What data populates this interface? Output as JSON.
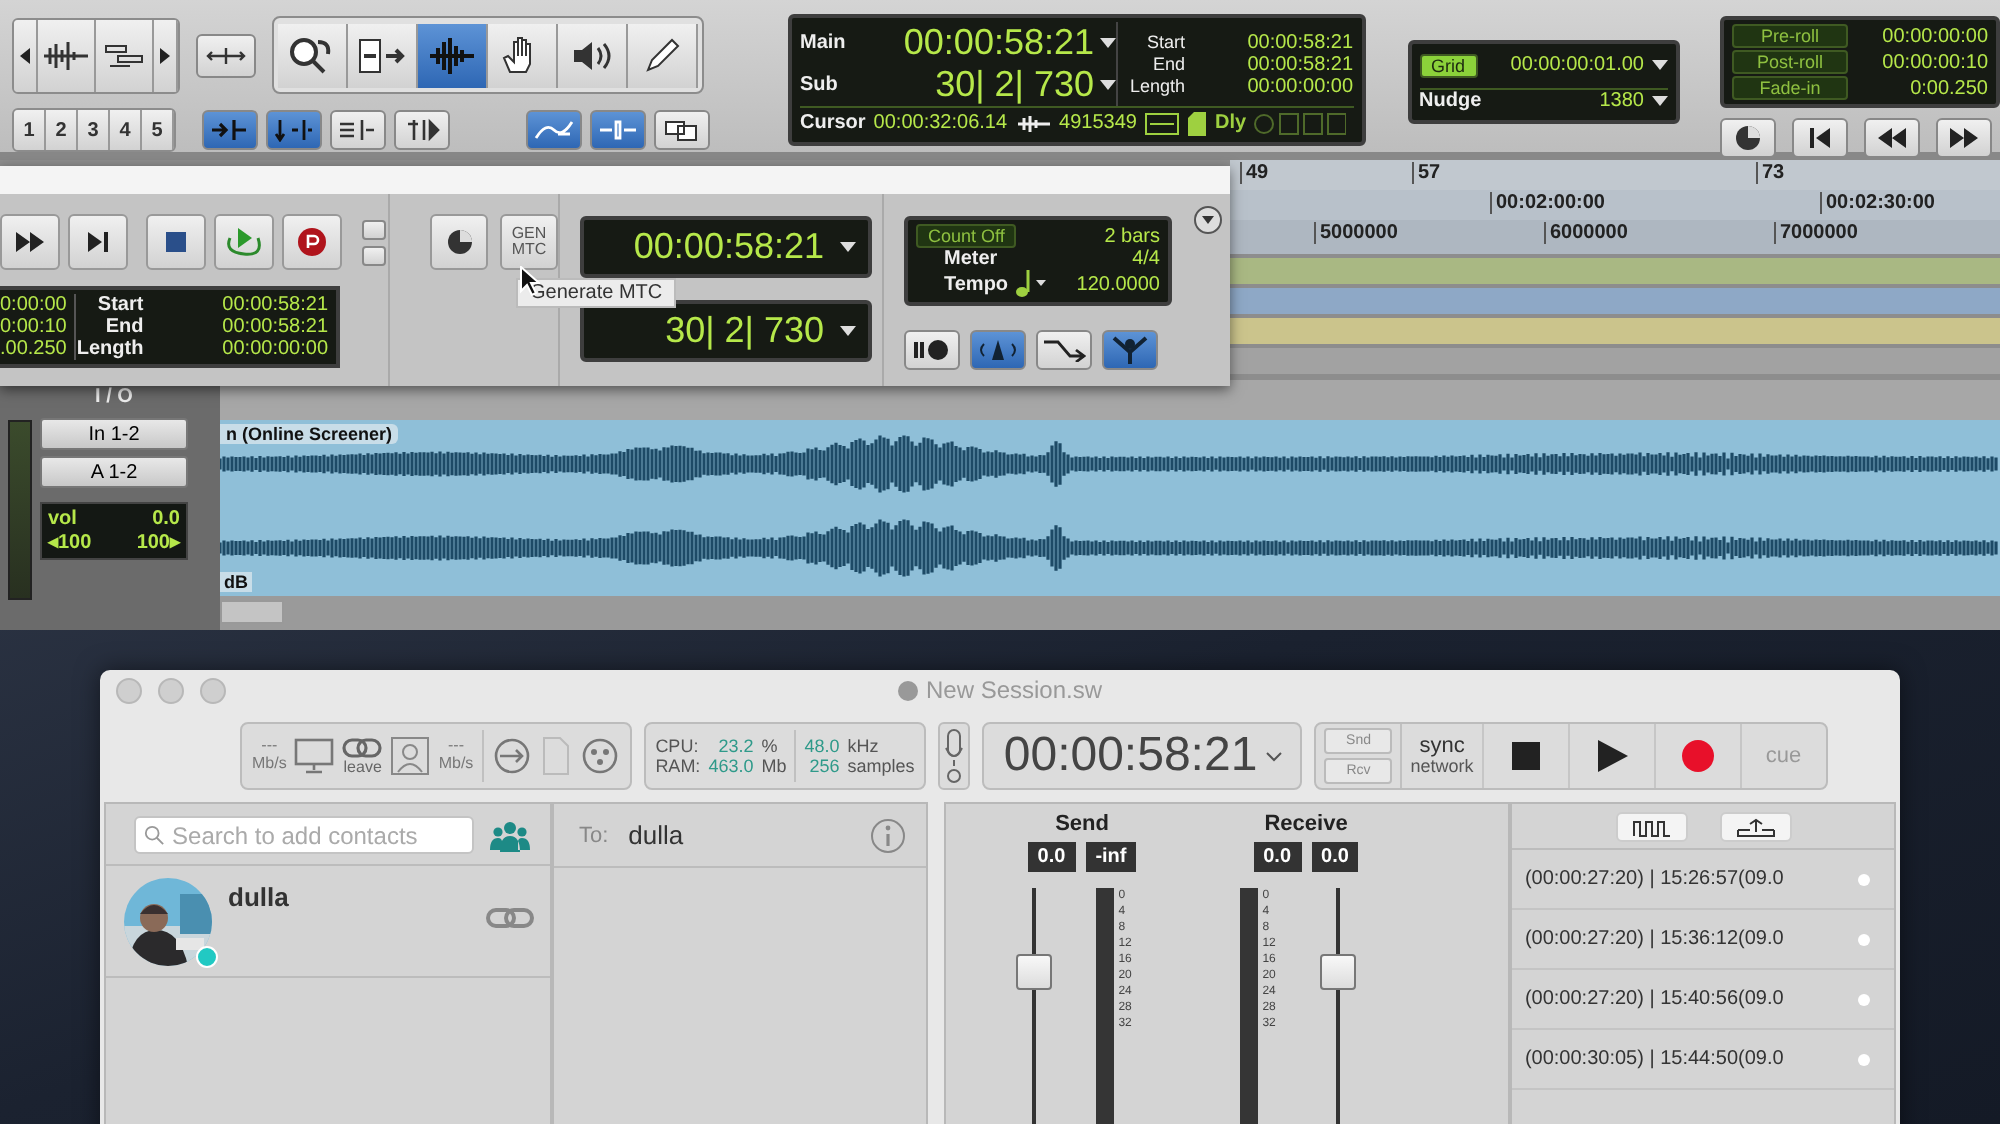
{
  "edit_window": {
    "toolbar": {
      "zoom_presets": [
        "1",
        "2",
        "3",
        "4",
        "5"
      ],
      "edit_tools": [
        {
          "kind": "zoomer",
          "selected": false
        },
        {
          "kind": "trim",
          "selected": false
        },
        {
          "kind": "selector",
          "selected": true
        },
        {
          "kind": "grabber",
          "selected": false
        },
        {
          "kind": "scrubber",
          "selected": false
        },
        {
          "kind": "pencil",
          "selected": false
        }
      ],
      "edit_options": [
        {
          "kind": "insert",
          "selected": true
        },
        {
          "kind": "split",
          "selected": true
        },
        {
          "kind": "lines",
          "selected": false
        },
        {
          "kind": "tab",
          "selected": false
        }
      ],
      "link_options": [
        {
          "kind": "curve",
          "selected": true
        },
        {
          "kind": "link",
          "selected": true
        },
        {
          "kind": "layers",
          "selected": false
        }
      ]
    },
    "counters": {
      "main_label": "Main",
      "main": "00:00:58:21",
      "sub_label": "Sub",
      "sub": "30| 2| 730",
      "start_label": "Start",
      "start": "00:00:58:21",
      "end_label": "End",
      "end": "00:00:58:21",
      "length_label": "Length",
      "length": "00:00:00:00",
      "cursor_label": "Cursor",
      "cursor": "00:00:32:06.14",
      "samples": "4915349",
      "delay": "Dly"
    },
    "grid": {
      "label": "Grid",
      "on": true,
      "value": "00:00:00:01.00",
      "nudge_label": "Nudge",
      "nudge": "1380"
    },
    "pre_post": [
      {
        "label": "Pre-roll",
        "on": false,
        "value": "00:00:00:00"
      },
      {
        "label": "Post-roll",
        "on": false,
        "value": "00:00:00:10"
      },
      {
        "label": "Fade-in",
        "on": false,
        "value": "0:00.250"
      }
    ],
    "transport_buttons": [
      {
        "kind": "online"
      },
      {
        "kind": "go_to_start"
      },
      {
        "kind": "rewind"
      },
      {
        "kind": "fast_forward"
      }
    ],
    "rulers": {
      "bars": [
        "49",
        "57",
        "73"
      ],
      "timecode": [
        "00:02:00:00",
        "00:02:30:00"
      ],
      "samples": [
        "5000000",
        "6000000",
        "7000000"
      ]
    },
    "track": {
      "io_header": "I / O",
      "input": "In 1-2",
      "output": "A 1-2",
      "vol_label": "vol",
      "vol": "0.0",
      "pan_left": "◂100",
      "pan_right": "100▸",
      "clip_name": "n (Online Screener)",
      "clip_gain": "dB"
    }
  },
  "transport_window": {
    "buttons": [
      {
        "kind": "fast_forward"
      },
      {
        "kind": "go_to_end"
      },
      {
        "kind": "stop"
      },
      {
        "kind": "loop_play"
      },
      {
        "kind": "record"
      }
    ],
    "selection": {
      "pre": [
        "0:00:00",
        "0:00:10",
        ".00.250"
      ],
      "start_label": "Start",
      "start": "00:00:58:21",
      "end_label": "End",
      "end": "00:00:58:21",
      "length_label": "Length",
      "length": "00:00:00:00"
    },
    "gen_mtc": "GEN MTC",
    "tooltip": "Generate MTC",
    "main_counter": "00:00:58:21",
    "sub_counter": "30| 2| 730",
    "count_off": {
      "label": "Count Off",
      "on": false,
      "bars": "2 bars",
      "meter_label": "Meter",
      "meter": "4/4",
      "tempo_label": "Tempo",
      "tempo": "120.0000"
    },
    "midi_buttons": [
      {
        "kind": "wait",
        "selected": false
      },
      {
        "kind": "metronome",
        "selected": true
      },
      {
        "kind": "merge",
        "selected": false
      },
      {
        "kind": "conductor",
        "selected": true
      }
    ]
  },
  "session_window": {
    "title": "New Session.sw",
    "network": {
      "send_rate": "---",
      "send_unit": "Mb/s",
      "leave": "leave",
      "recv_rate": "---",
      "recv_unit": "Mb/s"
    },
    "stats": {
      "cpu_label": "CPU:",
      "cpu": "23.2",
      "cpu_unit": "%",
      "ram_label": "RAM:",
      "ram": "463.0",
      "ram_unit": "Mb",
      "rate": "48.0",
      "rate_unit": "kHz",
      "buffer": "256",
      "buffer_unit": "samples"
    },
    "timecode": "00:00:58:21",
    "snd": "Snd",
    "rcv": "Rcv",
    "sync": "sync",
    "sync_sub": "network",
    "cue": "cue",
    "contacts": {
      "placeholder": "Search to add contacts",
      "items": [
        {
          "name": "dulla",
          "online": true
        }
      ]
    },
    "chat": {
      "to_label": "To:",
      "to": "dulla"
    },
    "mixer": [
      {
        "label": "Send",
        "values": [
          "0.0",
          "-inf"
        ],
        "kind": "fader_first",
        "level": 0.68,
        "scale": [
          "0",
          "4",
          "8",
          "12",
          "16",
          "20",
          "24",
          "28",
          "32"
        ]
      },
      {
        "label": "Receive",
        "values": [
          "0.0",
          "0.0"
        ],
        "kind": "meter_first",
        "level": 0.68,
        "scale": [
          "0",
          "4",
          "8",
          "12",
          "16",
          "20",
          "24",
          "28",
          "32"
        ]
      }
    ],
    "log": [
      "(00:00:27:20) | 15:26:57(09.0",
      "(00:00:27:20) | 15:36:12(09.0",
      "(00:00:27:20) | 15:40:56(09.0",
      "(00:00:30:05) | 15:44:50(09.0"
    ]
  }
}
